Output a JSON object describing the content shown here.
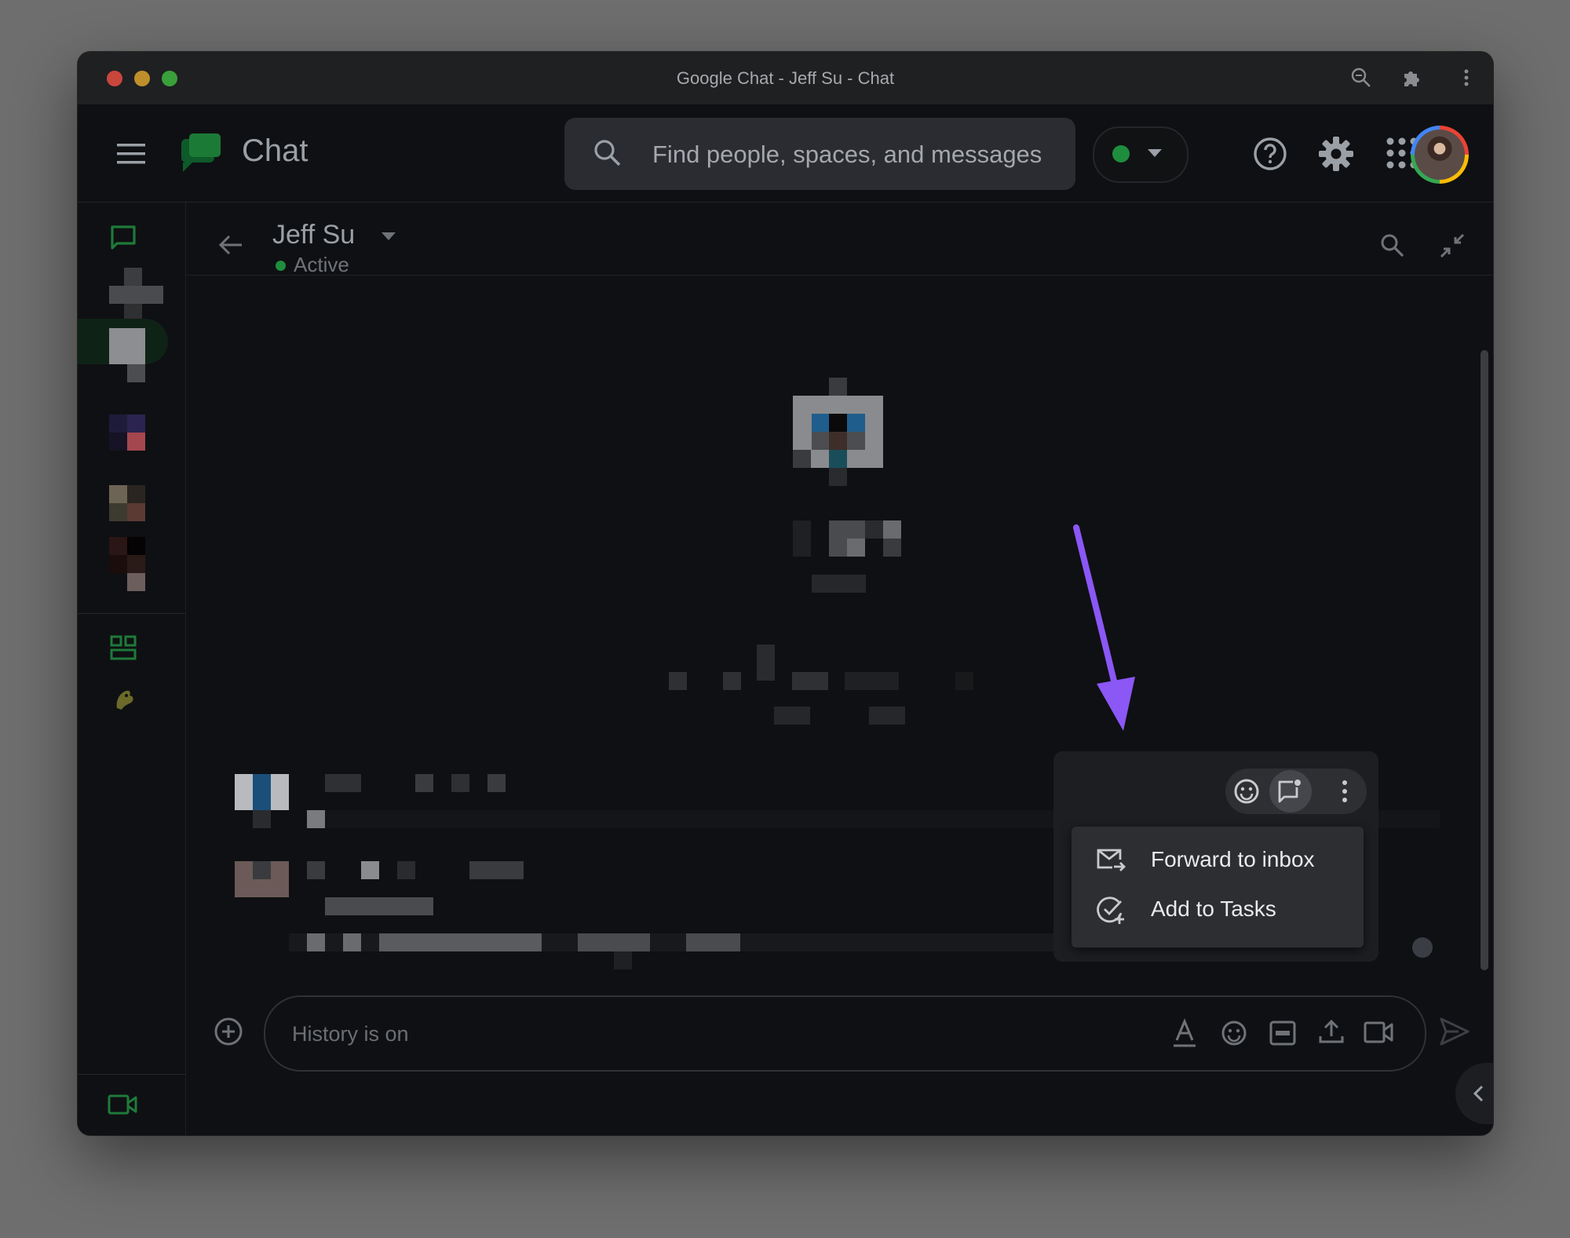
{
  "window": {
    "title": "Google Chat - Jeff Su - Chat"
  },
  "appbar": {
    "brand": "Chat",
    "search_placeholder": "Find people, spaces, and messages",
    "status_color": "#1e8e3e"
  },
  "conversation": {
    "name": "Jeff Su",
    "status": "Active"
  },
  "message_actions": {
    "menu": [
      {
        "label": "Forward to inbox",
        "icon": "forward-to-inbox-icon"
      },
      {
        "label": "Add to Tasks",
        "icon": "add-to-tasks-icon"
      }
    ]
  },
  "composer": {
    "placeholder": "History is on"
  },
  "colors": {
    "accent_green": "#1e8e3e",
    "annotation_arrow": "#8b57f5",
    "background": "#0f1013"
  }
}
